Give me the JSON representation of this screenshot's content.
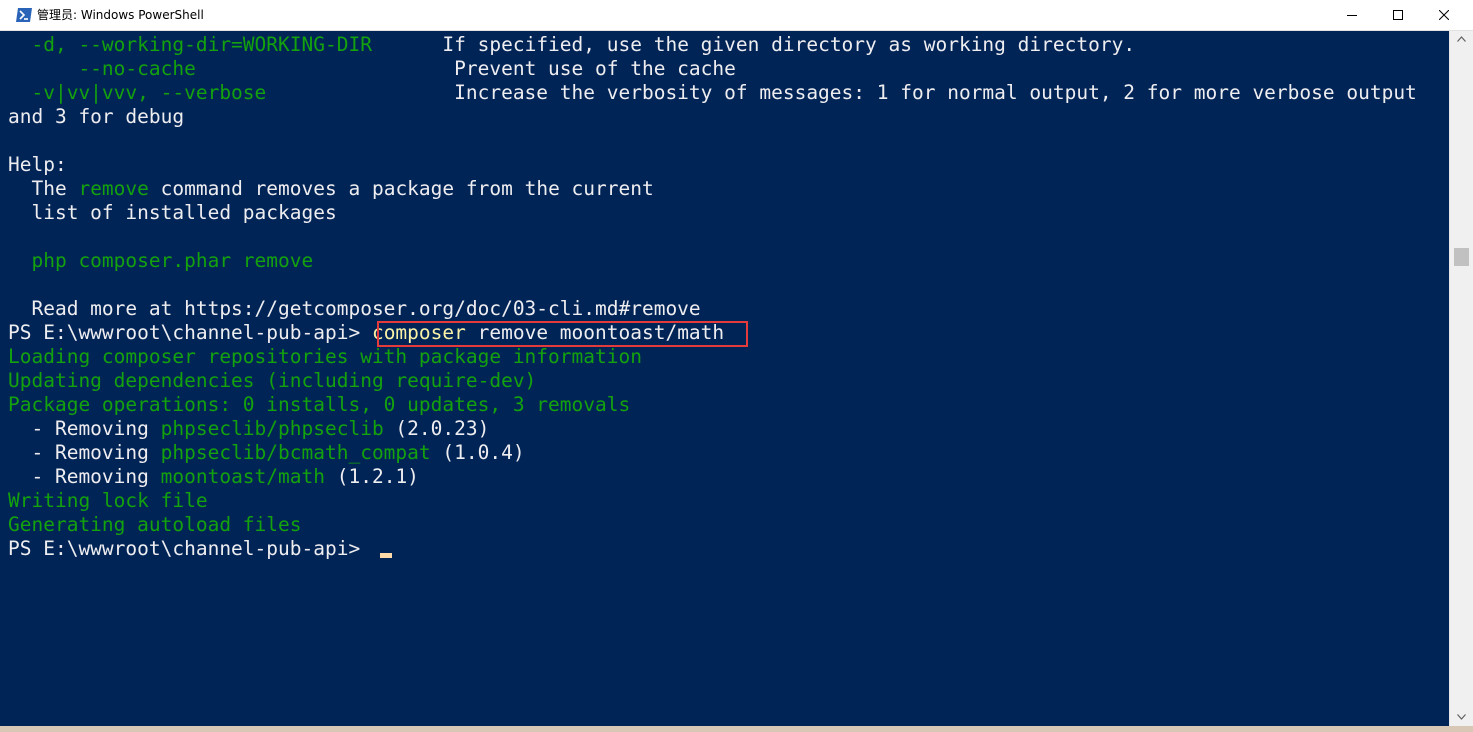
{
  "window": {
    "title": "管理员: Windows PowerShell",
    "icon": "powershell-icon",
    "controls": {
      "minimize": "minimize-icon",
      "maximize": "maximize-icon",
      "close": "close-icon"
    }
  },
  "colors": {
    "background": "#012456",
    "text": "#eeedf0",
    "green": "#13a10e",
    "command_yellow": "#f9f1a5",
    "highlight_border": "#e33b3b",
    "cursor": "#fedba9"
  },
  "terminal": {
    "lines": [
      {
        "segments": [
          {
            "text": "  -d, --working-dir=WORKING-DIR",
            "color": "green"
          },
          {
            "text": "      If specified, use the given directory as working directory.",
            "color": "white"
          }
        ]
      },
      {
        "segments": [
          {
            "text": "      --no-cache",
            "color": "green"
          },
          {
            "text": "                      Prevent use of the cache",
            "color": "white"
          }
        ]
      },
      {
        "segments": [
          {
            "text": "  -v|vv|vvv, --verbose",
            "color": "green"
          },
          {
            "text": "                Increase the verbosity of messages: 1 for normal output, 2 for more verbose output",
            "color": "white"
          }
        ]
      },
      {
        "segments": [
          {
            "text": "and 3 for debug",
            "color": "white"
          }
        ]
      },
      {
        "segments": [
          {
            "text": "",
            "color": "white"
          }
        ]
      },
      {
        "segments": [
          {
            "text": "Help:",
            "color": "white"
          }
        ]
      },
      {
        "segments": [
          {
            "text": "  The ",
            "color": "white"
          },
          {
            "text": "remove",
            "color": "green"
          },
          {
            "text": " command removes a package from the current",
            "color": "white"
          }
        ]
      },
      {
        "segments": [
          {
            "text": "  list of installed packages",
            "color": "white"
          }
        ]
      },
      {
        "segments": [
          {
            "text": "",
            "color": "white"
          }
        ]
      },
      {
        "segments": [
          {
            "text": "  php composer.phar remove",
            "color": "green"
          }
        ]
      },
      {
        "segments": [
          {
            "text": "",
            "color": "white"
          }
        ]
      },
      {
        "segments": [
          {
            "text": "  Read more at https://getcomposer.org/doc/03-cli.md#remove",
            "color": "white"
          }
        ]
      },
      {
        "segments": [
          {
            "text": "PS E:\\wwwroot\\channel-pub-api> ",
            "color": "white"
          },
          {
            "text": "composer",
            "color": "yellow"
          },
          {
            "text": " remove moontoast/math",
            "color": "white"
          }
        ]
      },
      {
        "segments": [
          {
            "text": "Loading composer repositories with package information",
            "color": "green"
          }
        ]
      },
      {
        "segments": [
          {
            "text": "Updating dependencies (including require-dev)",
            "color": "green"
          }
        ]
      },
      {
        "segments": [
          {
            "text": "Package operations: 0 installs, 0 updates, 3 removals",
            "color": "green"
          }
        ]
      },
      {
        "segments": [
          {
            "text": "  - Removing ",
            "color": "white"
          },
          {
            "text": "phpseclib/phpseclib",
            "color": "green"
          },
          {
            "text": " (2.0.23)",
            "color": "white"
          }
        ]
      },
      {
        "segments": [
          {
            "text": "  - Removing ",
            "color": "white"
          },
          {
            "text": "phpseclib/bcmath_compat",
            "color": "green"
          },
          {
            "text": " (1.0.4)",
            "color": "white"
          }
        ]
      },
      {
        "segments": [
          {
            "text": "  - Removing ",
            "color": "white"
          },
          {
            "text": "moontoast/math",
            "color": "green"
          },
          {
            "text": " (1.2.1)",
            "color": "white"
          }
        ]
      },
      {
        "segments": [
          {
            "text": "Writing lock file",
            "color": "green"
          }
        ]
      },
      {
        "segments": [
          {
            "text": "Generating autoload files",
            "color": "green"
          }
        ]
      },
      {
        "segments": [
          {
            "text": "PS E:\\wwwroot\\channel-pub-api> ",
            "color": "white"
          }
        ]
      }
    ]
  }
}
